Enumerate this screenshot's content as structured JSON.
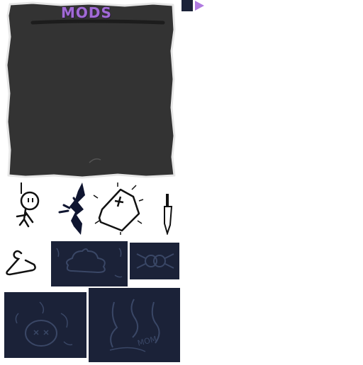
{
  "mods_panel": {
    "title": "MODS",
    "title_color": "#a16ad6",
    "panel_color": "#333333",
    "border_color": "#e6e6e6"
  },
  "colors": {
    "dark_tile": "#1b2238",
    "sketch_line": "#3a4766",
    "arrow": "#b07ae0"
  },
  "icons": [
    "small-square-icon",
    "play-arrow-icon",
    "hanging-stickman-icon",
    "splash-icon",
    "gravestone-icon",
    "knife-icon",
    "coat-hanger-icon",
    "poop-icon",
    "spider-icon",
    "dead-head-icon",
    "mom-icon"
  ],
  "mom_label": "MOM"
}
